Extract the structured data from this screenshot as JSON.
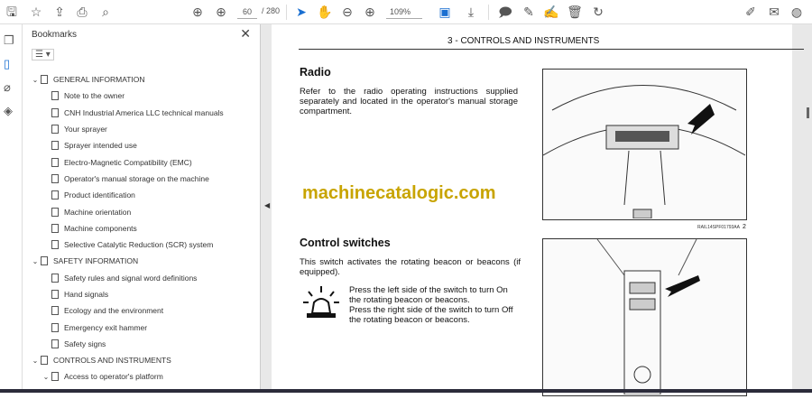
{
  "toolbar": {
    "page_current": "60",
    "page_total": "/ 280",
    "zoom": "109%"
  },
  "bookmarks": {
    "title": "Bookmarks",
    "items": [
      {
        "label": "GENERAL INFORMATION",
        "level": 0,
        "expanded": true
      },
      {
        "label": "Note to the owner",
        "level": 1
      },
      {
        "label": "CNH Industrial America LLC technical manuals",
        "level": 1
      },
      {
        "label": "Your sprayer",
        "level": 1
      },
      {
        "label": "Sprayer intended use",
        "level": 1
      },
      {
        "label": "Electro-Magnetic Compatibility (EMC)",
        "level": 1
      },
      {
        "label": "Operator's manual storage on the machine",
        "level": 1
      },
      {
        "label": "Product identification",
        "level": 1
      },
      {
        "label": "Machine orientation",
        "level": 1
      },
      {
        "label": "Machine components",
        "level": 1
      },
      {
        "label": "Selective Catalytic Reduction (SCR) system",
        "level": 1
      },
      {
        "label": "SAFETY INFORMATION",
        "level": 0,
        "expanded": true
      },
      {
        "label": "Safety rules and signal word definitions",
        "level": 1
      },
      {
        "label": "Hand signals",
        "level": 1
      },
      {
        "label": "Ecology and the environment",
        "level": 1
      },
      {
        "label": "Emergency exit hammer",
        "level": 1
      },
      {
        "label": "Safety signs",
        "level": 1
      },
      {
        "label": "CONTROLS AND INSTRUMENTS",
        "level": 0,
        "expanded": true
      },
      {
        "label": "Access to operator's platform",
        "level": 1,
        "expanded": true
      }
    ]
  },
  "document": {
    "header": "3 - CONTROLS AND INSTRUMENTS",
    "radio_title": "Radio",
    "radio_text": "Refer to the radio operating instructions supplied separately and located in the operator's manual storage compartment.",
    "watermark": "machinecatalogic.com",
    "fig1_caption": "RAIL14SPF01793AA",
    "fig1_number": "2",
    "switch_title": "Control switches",
    "switch_text": "This switch activates the rotating beacon or beacons (if equipped).",
    "switch_on": "Press the left side of the switch to turn On the rotating beacon or beacons.",
    "switch_off": "Press the right side of the switch to turn Off the rotating beacon or beacons."
  }
}
